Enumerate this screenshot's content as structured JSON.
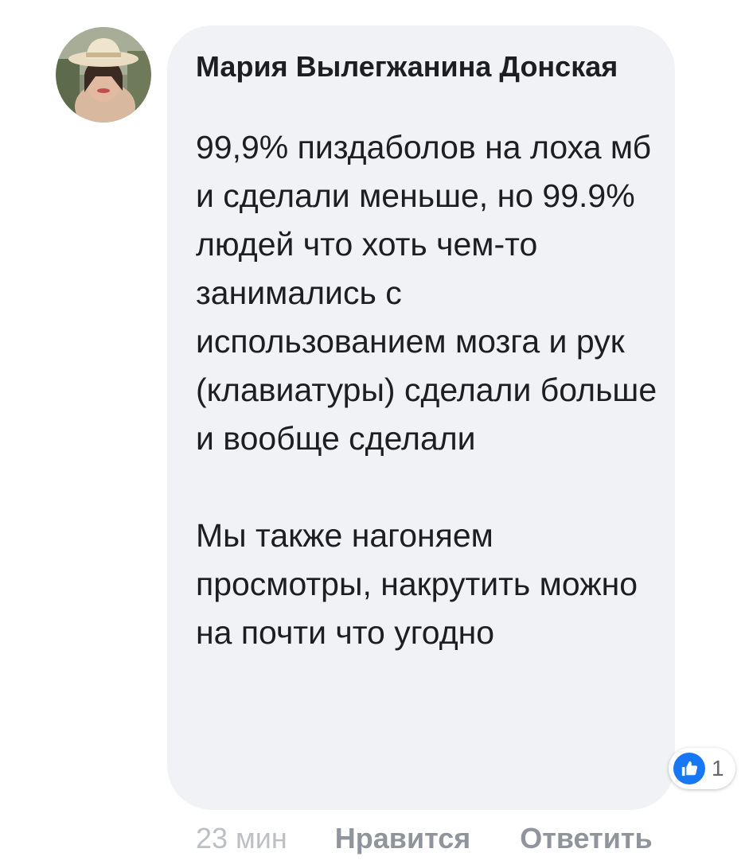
{
  "comment": {
    "author": "Мария Вылегжанина Донская",
    "text": "99,9% пиздаболов на лоха мб и сделали меньше, но 99.9% людей что хоть чем-то занимались с использованием мозга и рук (клавиатуры) сделали больше и вообще сделали\n\nМы также нагоняем просмотры, накрутить можно на почти что угодно",
    "avatar_icon": "profile-photo",
    "reaction_count": "1",
    "reaction_icon": "like-icon",
    "time": "23 мин",
    "like_label": "Нравится",
    "reply_label": "Ответить"
  },
  "colors": {
    "bubble": "#f0f2f5",
    "text": "#1c1e21",
    "like_blue": "#1877f2",
    "meta_gray": "#90949c"
  }
}
